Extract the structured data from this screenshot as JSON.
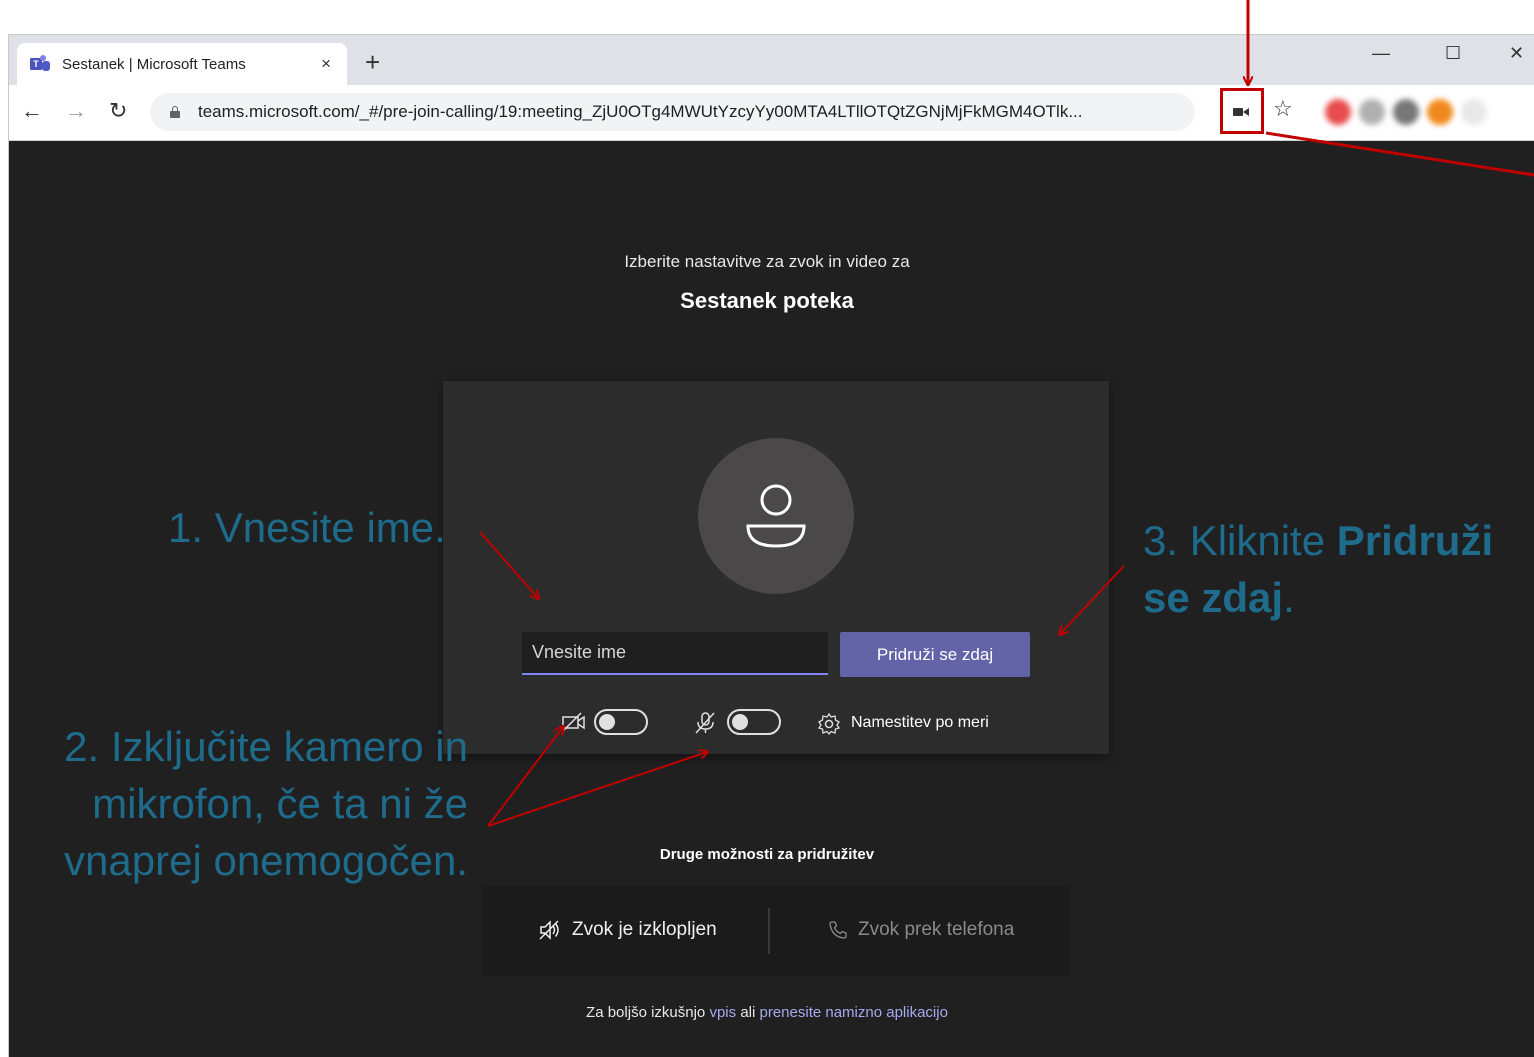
{
  "browser": {
    "tab_title": "Sestanek | Microsoft Teams",
    "tab_close": "×",
    "new_tab": "+",
    "window_controls": [
      "—",
      "☐",
      "✕"
    ],
    "url": "teams.microsoft.com/_#/pre-join-calling/19:meeting_ZjU0OTg4MWUtYzcyYy00MTA4LTllOTQtZGNjMjFkMGM4OTlk..."
  },
  "page": {
    "subtitle": "Izberite nastavitve za zvok in video za",
    "meeting_title": "Sestanek poteka",
    "name_placeholder": "Vnesite ime",
    "join_label": "Pridruži se zdaj",
    "custom_setup_label": "Namestitev po meri",
    "other_title": "Druge možnosti za pridružitev",
    "audio_off_label": "Zvok je izklopljen",
    "phone_audio_label": "Zvok prek telefona",
    "footer_prefix": "Za boljšo izkušnjo",
    "footer_signin": "vpis",
    "footer_or": "ali",
    "footer_download": "prenesite namizno aplikacijo"
  },
  "annotations": {
    "step1": "1. Vnesite ime.",
    "step2_line1": "2. Izključite kamero in",
    "step2_line2": "mikrofon, če ta ni že",
    "step2_line3": "vnaprej onemogočen.",
    "step3_prefix": "3. Kliknite",
    "step3_bold": "Pridruži se zdaj",
    "step3_suffix": "."
  },
  "colors": {
    "annotation_text": "#1e6b8c",
    "arrow": "#c00000",
    "join_button": "#6264a7",
    "page_background": "#202020"
  }
}
